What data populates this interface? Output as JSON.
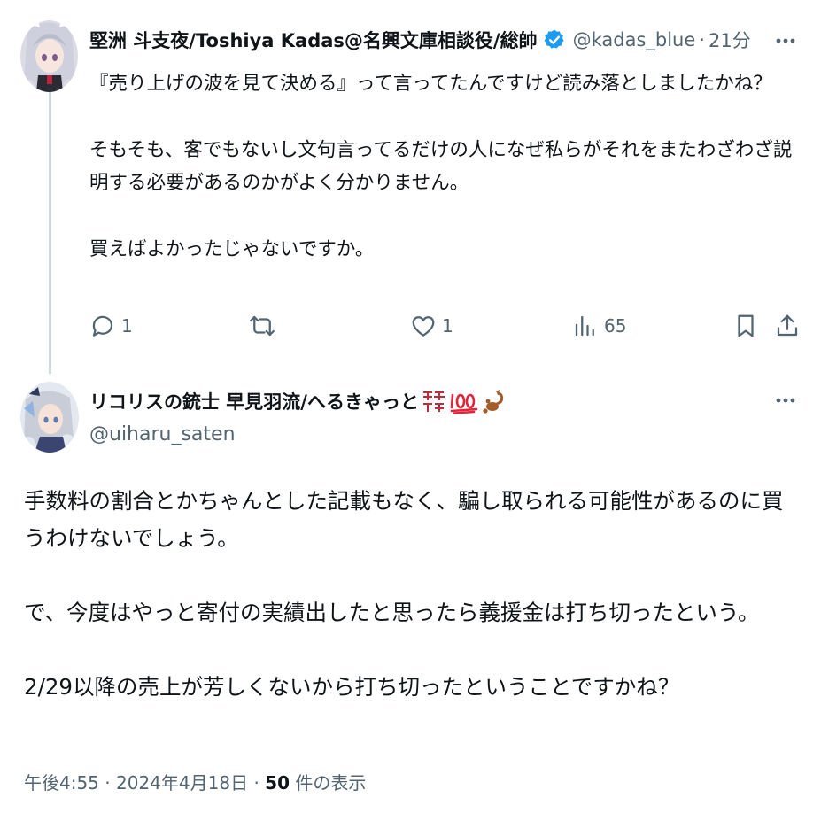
{
  "parent_tweet": {
    "display_name": "堅洲 斗支夜/Toshiya Kadas@名興文庫相談役/総帥",
    "handle": "@kadas_blue",
    "separator": "·",
    "time": "21分",
    "paragraphs": [
      "『売り上げの波を見て決める』って言ってたんですけど読み落としましたかね？",
      "そもそも、客でもないし文句言ってるだけの人になぜ私らがそれをまたわざわざ説明する必要があるのかがよく分かりません。",
      "買えばよかったじゃないですか。"
    ],
    "actions": {
      "reply_count": "1",
      "retweet_count": "",
      "like_count": "1",
      "view_count": "65"
    }
  },
  "main_tweet": {
    "display_name": "リコリスの銃士 早見羽流/へるきゃっと",
    "handle": "@uiharu_saten",
    "paragraphs": [
      "手数料の割合とかちゃんとした記載もなく、騙し取られる可能性があるのに買うわけないでしょう。",
      "で、今度はやっと寄付の実績出したと思ったら義援金は打ち切ったという。",
      "2/29以降の売上が芳しくないから打ち切ったということですかね？"
    ],
    "meta": {
      "time": "午後4:55",
      "sep1": "·",
      "date": "2024年4月18日",
      "sep2": "·",
      "views_count": "50",
      "views_label": "件の表示"
    }
  },
  "colors": {
    "text": "#0f1419",
    "secondary": "#536471",
    "verified": "#1d9bf0",
    "thread_line": "#cfd9de"
  }
}
